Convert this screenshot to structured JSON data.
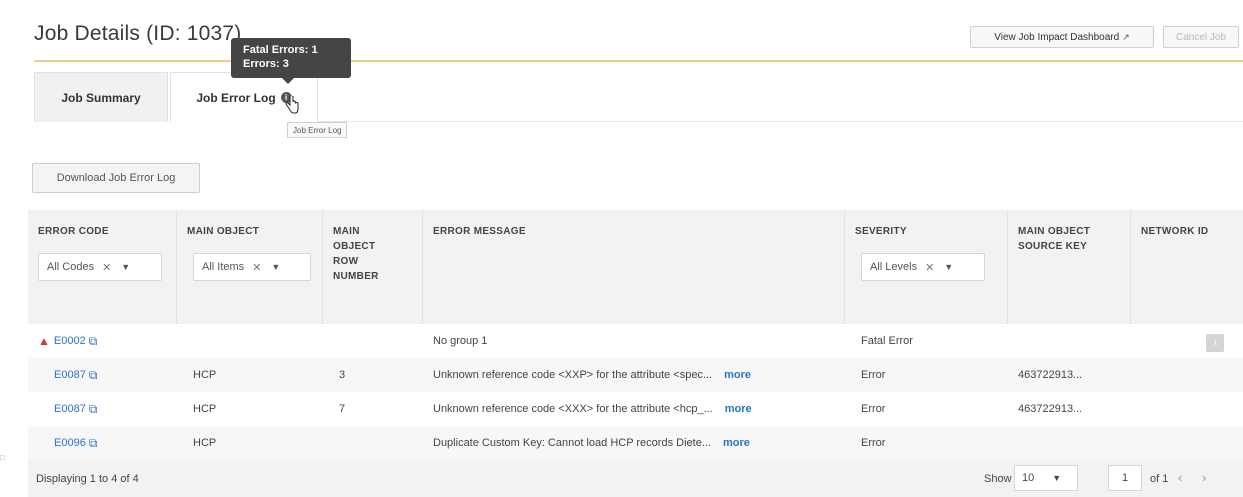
{
  "header": {
    "title": "Job Details (ID: 1037)",
    "impact_button": "View Job Impact Dashboard",
    "cancel_button": "Cancel Job",
    "accent_color": "#f2cf85"
  },
  "tooltip": {
    "line1": "Fatal Errors: 1",
    "line2": "Errors: 3"
  },
  "tabs": [
    {
      "label": "Job Summary",
      "active": false
    },
    {
      "label": "Job Error Log",
      "active": true
    }
  ],
  "tab_hint": "Job Error Log",
  "download_button": "Download Job Error Log",
  "table": {
    "columns": [
      {
        "title": "ERROR CODE",
        "filter": "All Codes"
      },
      {
        "title": "MAIN OBJECT",
        "filter": "All Items"
      },
      {
        "title": "MAIN OBJECT ROW NUMBER"
      },
      {
        "title": "ERROR MESSAGE"
      },
      {
        "title": "SEVERITY",
        "filter": "All Levels"
      },
      {
        "title": "MAIN OBJECT SOURCE KEY"
      },
      {
        "title": "NETWORK ID"
      }
    ],
    "more_label": "more",
    "rows": [
      {
        "code": "E0002",
        "warning": true,
        "object": "",
        "row_number": "",
        "message": "No group 1",
        "has_more": false,
        "severity": "Fatal Error",
        "source_key": "",
        "network_id": ""
      },
      {
        "code": "E0087",
        "warning": false,
        "object": "HCP",
        "row_number": "3",
        "message": "Unknown reference code <XXP> for the attribute <spec...",
        "has_more": true,
        "severity": "Error",
        "source_key": "463722913...",
        "network_id": ""
      },
      {
        "code": "E0087",
        "warning": false,
        "object": "HCP",
        "row_number": "7",
        "message": "Unknown reference code <XXX> for the attribute <hcp_...",
        "has_more": true,
        "severity": "Error",
        "source_key": "463722913...",
        "network_id": ""
      },
      {
        "code": "E0096",
        "warning": false,
        "object": "HCP",
        "row_number": "",
        "message": "Duplicate Custom Key: Cannot load HCP records Diete...",
        "has_more": true,
        "severity": "Error",
        "source_key": "",
        "network_id": ""
      }
    ]
  },
  "footer": {
    "status": "Displaying 1 to 4 of 4",
    "show_label": "Show",
    "page_size": "10",
    "page": "1",
    "of_label": "of 1"
  },
  "link_color": "#2a74c8",
  "icons": {
    "external": "external-link-icon",
    "warning": "warning-triangle-icon",
    "info": "info-icon",
    "cursor": "hand-cursor-icon"
  }
}
